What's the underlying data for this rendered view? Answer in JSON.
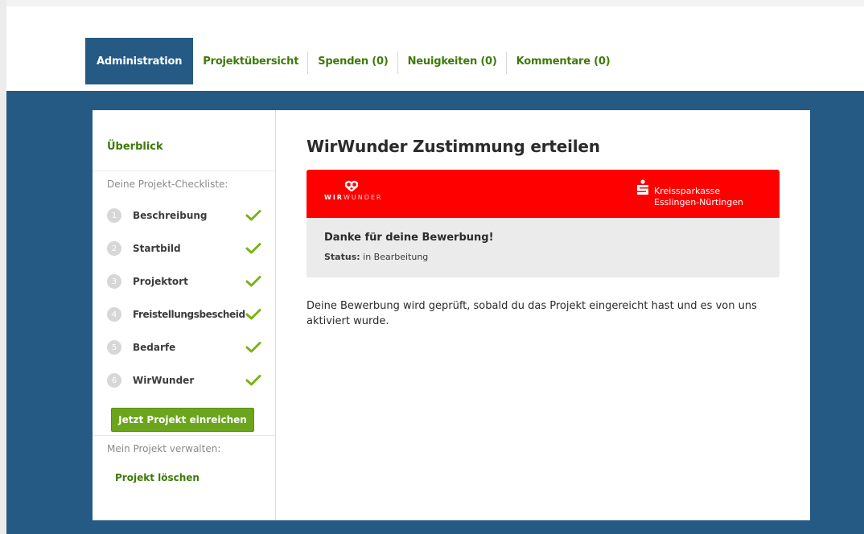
{
  "nav": {
    "tabs": [
      {
        "label": "Administration",
        "active": true
      },
      {
        "label": "Projektübersicht",
        "active": false
      },
      {
        "label": "Spenden (0)",
        "active": false
      },
      {
        "label": "Neuigkeiten (0)",
        "active": false
      },
      {
        "label": "Kommentare (0)",
        "active": false
      }
    ]
  },
  "sidebar": {
    "overview_link": "Überblick",
    "checklist_label": "Deine Projekt-Checkliste:",
    "steps": [
      {
        "num": "1",
        "label": "Beschreibung",
        "done": true
      },
      {
        "num": "2",
        "label": "Startbild",
        "done": true
      },
      {
        "num": "3",
        "label": "Projektort",
        "done": true
      },
      {
        "num": "4",
        "label": "Freistellungsbescheid",
        "done": true
      },
      {
        "num": "5",
        "label": "Bedarfe",
        "done": true
      },
      {
        "num": "6",
        "label": "WirWunder",
        "done": true
      }
    ],
    "submit_button": "Jetzt Projekt einreichen",
    "manage_label": "Mein Projekt verwalten:",
    "delete_link": "Projekt löschen"
  },
  "main": {
    "title": "WirWunder Zustimmung erteilen",
    "banner": {
      "logo_text_bold": "WIR",
      "logo_text_thin": "WUNDER",
      "sponsor_line1": "Kreissparkasse",
      "sponsor_line2": "Esslingen-Nürtingen"
    },
    "thanks": "Danke für deine Bewerbung!",
    "status_label": "Status:",
    "status_value": "in Bearbeitung",
    "body": "Deine Bewerbung wird geprüft, sobald du das Projekt eingereicht hast und es von uns aktiviert wurde."
  },
  "colors": {
    "brand_blue": "#255a85",
    "brand_green": "#3d7a0a",
    "button_green": "#6aa51c",
    "check_green": "#7ab317",
    "banner_red": "#ff0000"
  }
}
